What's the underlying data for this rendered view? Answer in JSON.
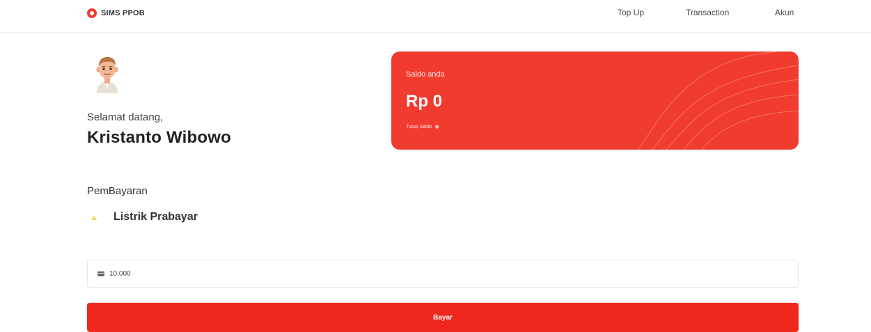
{
  "header": {
    "brand": "SIMS PPOB",
    "nav": {
      "topup": "Top Up",
      "transaction": "Transaction",
      "account": "Akun"
    }
  },
  "profile": {
    "greeting": "Selamat datang,",
    "name": "Kristanto Wibowo",
    "avatar_icon": "avatar-cartoon"
  },
  "balance": {
    "label": "Saldo anda",
    "amount": "Rp 0",
    "toggle_label": "Tutup Saldo",
    "toggle_icon": "eye-icon"
  },
  "payment": {
    "section_label": "PemBayaran",
    "service_name": "Listrik Prabayar",
    "service_icon": "lightbulb-icon",
    "amount_value": "10.000",
    "pay_label": "Bayar"
  },
  "colors": {
    "brand_red": "#f13b2f",
    "button_red": "#f0271c"
  }
}
